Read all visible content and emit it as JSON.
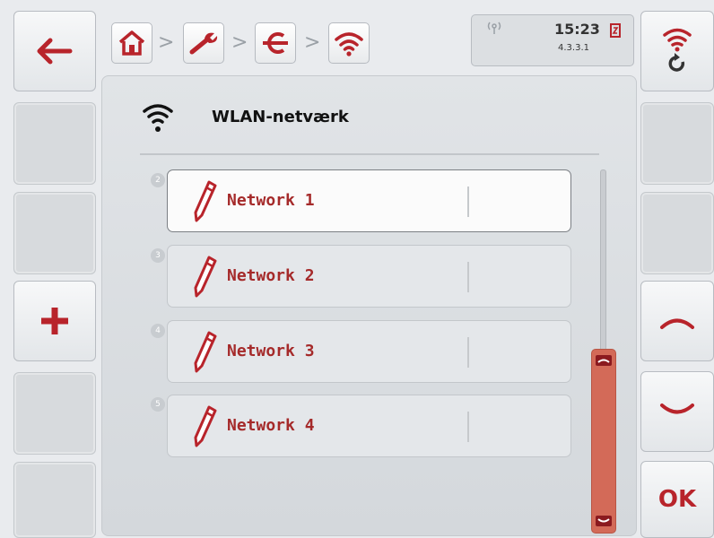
{
  "header": {
    "time": "15:23",
    "version": "4.3.3.1",
    "breadcrumb_icons": [
      "home-icon",
      "wrench-icon",
      "connector-icon",
      "wifi-icon"
    ]
  },
  "panel": {
    "title": "WLAN-netværk"
  },
  "networks": [
    {
      "label": "Network 1",
      "number": "2"
    },
    {
      "label": "Network 2",
      "number": "3"
    },
    {
      "label": "Network 3",
      "number": "4"
    },
    {
      "label": "Network 4",
      "number": "5"
    }
  ],
  "buttons": {
    "ok_label": "OK"
  },
  "colors": {
    "accent": "#b8242b",
    "scrollbar": "#d36a58"
  }
}
